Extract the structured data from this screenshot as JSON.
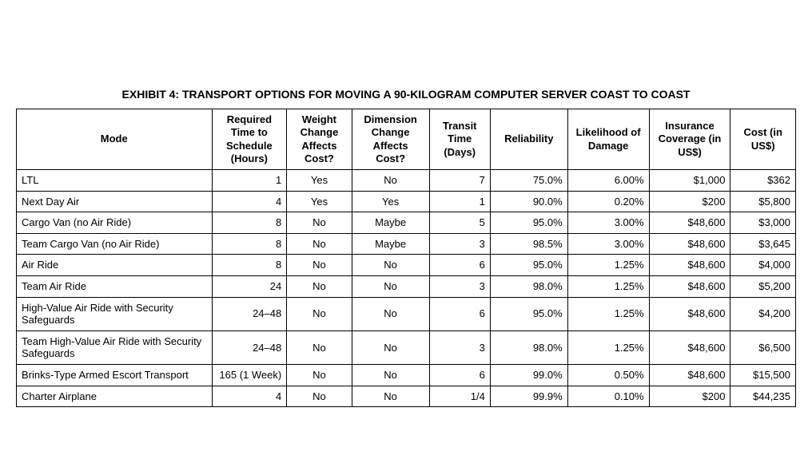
{
  "title": "EXHIBIT 4: TRANSPORT OPTIONS FOR MOVING A 90-KILOGRAM COMPUTER SERVER COAST TO COAST",
  "headers": {
    "mode": "Mode",
    "required_time": "Required Time to Schedule (Hours)",
    "weight_change": "Weight Change Affects Cost?",
    "dimension_change": "Dimension Change Affects Cost?",
    "transit_time": "Transit Time (Days)",
    "reliability": "Reliability",
    "likelihood_damage": "Likelihood of Damage",
    "insurance": "Insurance Coverage (in US$)",
    "cost": "Cost (in US$)"
  },
  "rows": [
    {
      "mode": "LTL",
      "required_time": "1",
      "weight_change": "Yes",
      "dimension_change": "No",
      "transit_time": "7",
      "reliability": "75.0%",
      "likelihood_damage": "6.00%",
      "insurance": "$1,000",
      "cost": "$362"
    },
    {
      "mode": "Next Day Air",
      "required_time": "4",
      "weight_change": "Yes",
      "dimension_change": "Yes",
      "transit_time": "1",
      "reliability": "90.0%",
      "likelihood_damage": "0.20%",
      "insurance": "$200",
      "cost": "$5,800"
    },
    {
      "mode": "Cargo Van (no Air Ride)",
      "required_time": "8",
      "weight_change": "No",
      "dimension_change": "Maybe",
      "transit_time": "5",
      "reliability": "95.0%",
      "likelihood_damage": "3.00%",
      "insurance": "$48,600",
      "cost": "$3,000"
    },
    {
      "mode": "Team Cargo Van (no Air Ride)",
      "required_time": "8",
      "weight_change": "No",
      "dimension_change": "Maybe",
      "transit_time": "3",
      "reliability": "98.5%",
      "likelihood_damage": "3.00%",
      "insurance": "$48,600",
      "cost": "$3,645"
    },
    {
      "mode": "Air Ride",
      "required_time": "8",
      "weight_change": "No",
      "dimension_change": "No",
      "transit_time": "6",
      "reliability": "95.0%",
      "likelihood_damage": "1.25%",
      "insurance": "$48,600",
      "cost": "$4,000"
    },
    {
      "mode": "Team Air Ride",
      "required_time": "24",
      "weight_change": "No",
      "dimension_change": "No",
      "transit_time": "3",
      "reliability": "98.0%",
      "likelihood_damage": "1.25%",
      "insurance": "$48,600",
      "cost": "$5,200"
    },
    {
      "mode": "High-Value Air Ride with Security Safeguards",
      "required_time": "24–48",
      "weight_change": "No",
      "dimension_change": "No",
      "transit_time": "6",
      "reliability": "95.0%",
      "likelihood_damage": "1.25%",
      "insurance": "$48,600",
      "cost": "$4,200"
    },
    {
      "mode": "Team High-Value Air Ride with Security Safeguards",
      "required_time": "24–48",
      "weight_change": "No",
      "dimension_change": "No",
      "transit_time": "3",
      "reliability": "98.0%",
      "likelihood_damage": "1.25%",
      "insurance": "$48,600",
      "cost": "$6,500"
    },
    {
      "mode": "Brinks-Type Armed Escort Transport",
      "required_time": "165 (1 Week)",
      "weight_change": "No",
      "dimension_change": "No",
      "transit_time": "6",
      "reliability": "99.0%",
      "likelihood_damage": "0.50%",
      "insurance": "$48,600",
      "cost": "$15,500"
    },
    {
      "mode": "Charter Airplane",
      "required_time": "4",
      "weight_change": "No",
      "dimension_change": "No",
      "transit_time": "1/4",
      "reliability": "99.9%",
      "likelihood_damage": "0.10%",
      "insurance": "$200",
      "cost": "$44,235"
    }
  ],
  "chart_data": {
    "type": "table",
    "title": "EXHIBIT 4: TRANSPORT OPTIONS FOR MOVING A 90-KILOGRAM COMPUTER SERVER COAST TO COAST",
    "columns": [
      "Mode",
      "Required Time to Schedule (Hours)",
      "Weight Change Affects Cost?",
      "Dimension Change Affects Cost?",
      "Transit Time (Days)",
      "Reliability",
      "Likelihood of Damage",
      "Insurance Coverage (in US$)",
      "Cost (in US$)"
    ],
    "rows": [
      [
        "LTL",
        "1",
        "Yes",
        "No",
        "7",
        "75.0%",
        "6.00%",
        "$1,000",
        "$362"
      ],
      [
        "Next Day Air",
        "4",
        "Yes",
        "Yes",
        "1",
        "90.0%",
        "0.20%",
        "$200",
        "$5,800"
      ],
      [
        "Cargo Van (no Air Ride)",
        "8",
        "No",
        "Maybe",
        "5",
        "95.0%",
        "3.00%",
        "$48,600",
        "$3,000"
      ],
      [
        "Team Cargo Van (no Air Ride)",
        "8",
        "No",
        "Maybe",
        "3",
        "98.5%",
        "3.00%",
        "$48,600",
        "$3,645"
      ],
      [
        "Air Ride",
        "8",
        "No",
        "No",
        "6",
        "95.0%",
        "1.25%",
        "$48,600",
        "$4,000"
      ],
      [
        "Team Air Ride",
        "24",
        "No",
        "No",
        "3",
        "98.0%",
        "1.25%",
        "$48,600",
        "$5,200"
      ],
      [
        "High-Value Air Ride with Security Safeguards",
        "24–48",
        "No",
        "No",
        "6",
        "95.0%",
        "1.25%",
        "$48,600",
        "$4,200"
      ],
      [
        "Team High-Value Air Ride with Security Safeguards",
        "24–48",
        "No",
        "No",
        "3",
        "98.0%",
        "1.25%",
        "$48,600",
        "$6,500"
      ],
      [
        "Brinks-Type Armed Escort Transport",
        "165 (1 Week)",
        "No",
        "No",
        "6",
        "99.0%",
        "0.50%",
        "$48,600",
        "$15,500"
      ],
      [
        "Charter Airplane",
        "4",
        "No",
        "No",
        "1/4",
        "99.9%",
        "0.10%",
        "$200",
        "$44,235"
      ]
    ]
  }
}
